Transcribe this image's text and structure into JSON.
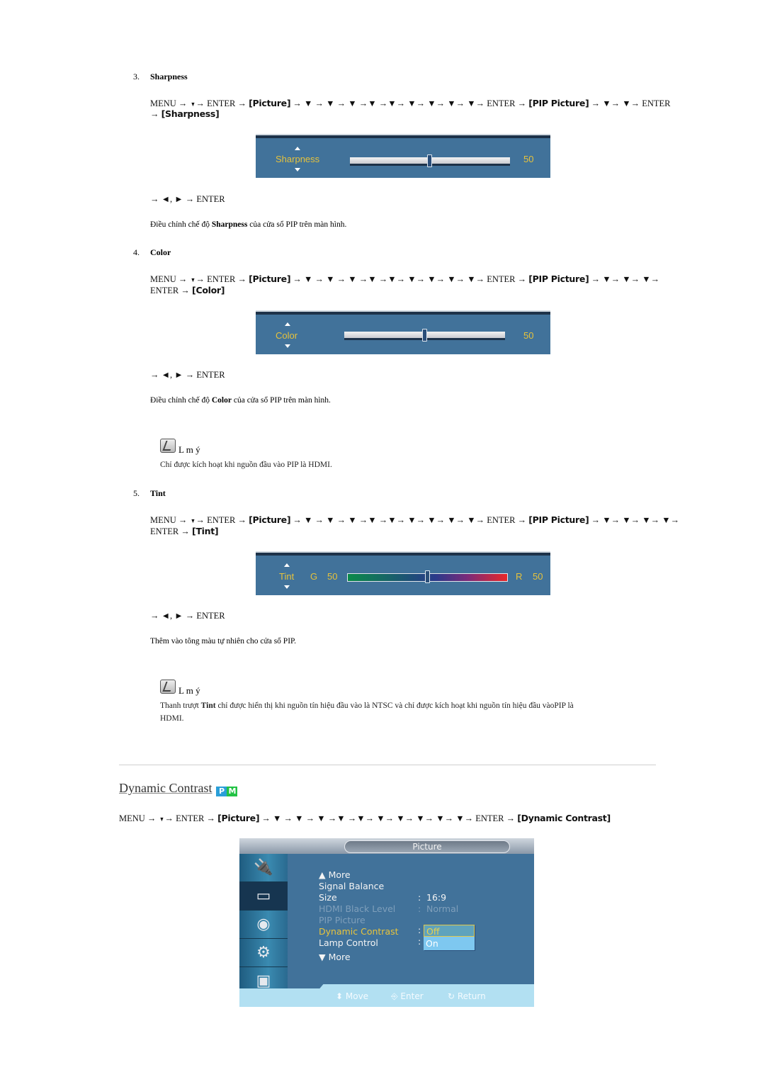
{
  "sections": [
    {
      "number": "3.",
      "title": "Sharpness",
      "path_line1": [
        {
          "t": "kw",
          "v": "MENU → "
        },
        {
          "t": "dn",
          "v": "▼"
        },
        {
          "t": "kw",
          "v": "→ ENTER → "
        },
        {
          "t": "bk",
          "v": "[Picture]"
        },
        {
          "t": "kw",
          "v": " → ▼ → ▼ → ▼ →▼ →▼→ ▼→ ▼→ ▼→ ▼→ ENTER → "
        },
        {
          "t": "bk",
          "v": "[PIP Picture]"
        },
        {
          "t": "kw",
          "v": " → ▼→ ▼→ ENTER"
        }
      ],
      "path_line2": [
        {
          "t": "kw",
          "v": "→ "
        },
        {
          "t": "bk",
          "v": "[Sharpness]"
        }
      ],
      "osd": {
        "label": "Sharpness",
        "value": "50",
        "level_percent": 50
      },
      "adjust": "→ ◄, ► → ENTER",
      "desc_pre": "Điều chỉnh chế độ ",
      "desc_bold": "Sharpness",
      "desc_post": " của cửa sổ PIP trên màn hình."
    },
    {
      "number": "4.",
      "title": "Color",
      "path_line1": [
        {
          "t": "kw",
          "v": "MENU → "
        },
        {
          "t": "dn",
          "v": "▼"
        },
        {
          "t": "kw",
          "v": "→ ENTER → "
        },
        {
          "t": "bk",
          "v": "[Picture]"
        },
        {
          "t": "kw",
          "v": " → ▼ → ▼ → ▼ →▼ →▼→ ▼→ ▼→ ▼→ ▼→ ENTER → "
        },
        {
          "t": "bk",
          "v": "[PIP Picture]"
        },
        {
          "t": "kw",
          "v": " → ▼→ ▼→ ▼→"
        }
      ],
      "path_line2": [
        {
          "t": "kw",
          "v": "ENTER → "
        },
        {
          "t": "bk",
          "v": "[Color]"
        }
      ],
      "osd": {
        "label": "Color",
        "value": "50",
        "level_percent": 50
      },
      "adjust": "→ ◄, ► → ENTER",
      "desc_pre": "Điều chỉnh chế độ ",
      "desc_bold": "Color",
      "desc_post": " của cửa sổ PIP trên màn hình.",
      "note": {
        "title": "L m ý",
        "text": "Chỉ được kích hoạt khi nguồn đầu vào PIP là HDMI."
      }
    },
    {
      "number": "5.",
      "title": "Tint",
      "path_line1": [
        {
          "t": "kw",
          "v": "MENU → "
        },
        {
          "t": "dn",
          "v": "▼"
        },
        {
          "t": "kw",
          "v": "→ ENTER → "
        },
        {
          "t": "bk",
          "v": "[Picture]"
        },
        {
          "t": "kw",
          "v": " → ▼ → ▼ → ▼ →▼ →▼→ ▼→ ▼→ ▼→ ▼→ ENTER → "
        },
        {
          "t": "bk",
          "v": "[PIP Picture]"
        },
        {
          "t": "kw",
          "v": " → ▼→ ▼→ ▼→ ▼→"
        }
      ],
      "path_line2": [
        {
          "t": "kw",
          "v": "ENTER → "
        },
        {
          "t": "bk",
          "v": "[Tint]"
        }
      ],
      "osd": {
        "label": "Tint",
        "g_label": "G",
        "g_value": "50",
        "r_label": "R",
        "r_value": "50",
        "level_percent": 50
      },
      "adjust": "→ ◄, ► → ENTER",
      "desc": "Thêm vào tông màu tự nhiên cho cửa sổ PIP.",
      "note": {
        "title": "L m ý",
        "text_pre": "Thanh trượt ",
        "text_bold": "Tint",
        "text_post": " chỉ được hiển thị khi nguồn tín hiệu đầu vào là NTSC và chỉ được kích hoạt khi nguồn tín hiệu đầu vàoPIP là",
        "text_line2": "HDMI."
      }
    }
  ],
  "dynamic_contrast": {
    "title": "Dynamic Contrast",
    "badge": [
      "P",
      "M"
    ],
    "badge_colors": {
      "P": "#2a9fd8",
      "M": "#22c244"
    },
    "path": [
      {
        "t": "kw",
        "v": "MENU → "
      },
      {
        "t": "dn",
        "v": "▼"
      },
      {
        "t": "kw",
        "v": "→ ENTER → "
      },
      {
        "t": "bk",
        "v": "[Picture]"
      },
      {
        "t": "kw",
        "v": " → ▼ → ▼ → ▼ →▼ →▼→ ▼→ ▼→ ▼→ ▼→ ▼→ ENTER → "
      },
      {
        "t": "bk",
        "v": "[Dynamic Contrast]"
      }
    ],
    "menu": {
      "title": "Picture",
      "sidebar_icons": [
        "input-icon",
        "picture-icon",
        "sound-icon",
        "setup-icon",
        "multi-control-icon"
      ],
      "active_sidebar_index": 1,
      "items": [
        {
          "label": "▲ More",
          "state": "normal"
        },
        {
          "label": "Signal Balance",
          "state": "normal"
        },
        {
          "label": "Size",
          "state": "normal",
          "value": "16:9"
        },
        {
          "label": "HDMI Black Level",
          "state": "dim",
          "value": "Normal"
        },
        {
          "label": "PIP Picture",
          "state": "dim"
        },
        {
          "label": "Dynamic Contrast",
          "state": "sel"
        },
        {
          "label": "Lamp Control",
          "state": "normal"
        },
        {
          "label": "▼ More",
          "state": "normal"
        }
      ],
      "colon": ":",
      "dropdown_options": [
        {
          "label": "Off",
          "selected": true
        },
        {
          "label": "On",
          "selected": false
        }
      ],
      "hints": {
        "move": "Move",
        "enter": "Enter",
        "return": "Return"
      }
    }
  }
}
